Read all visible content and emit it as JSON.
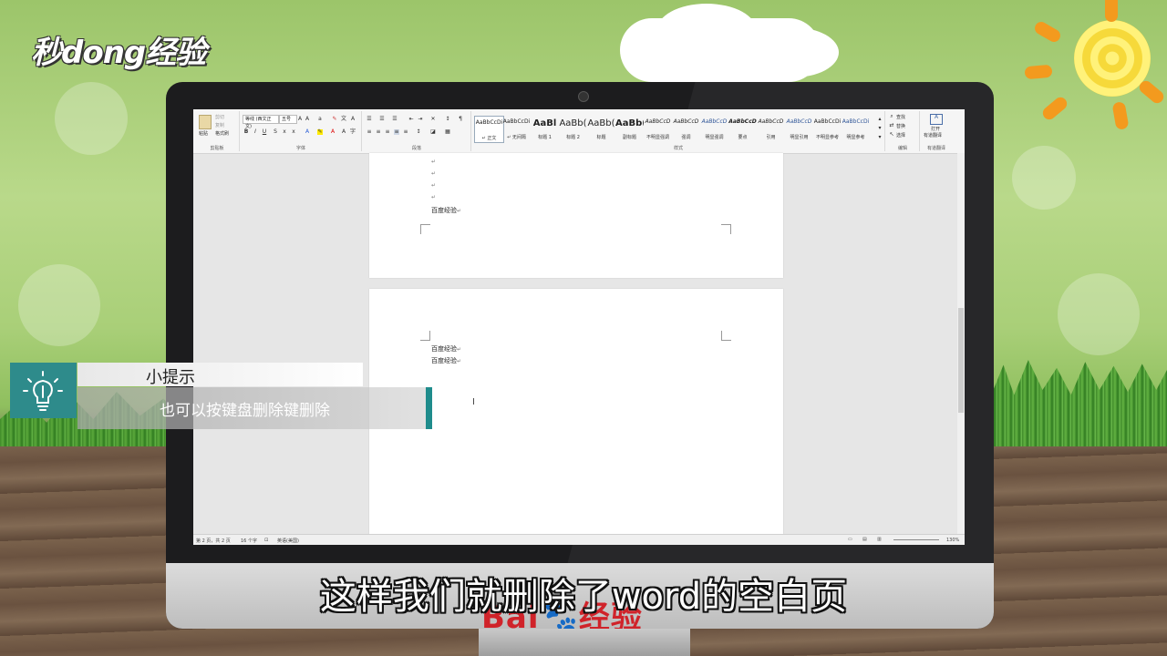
{
  "brand": {
    "logo": "秒dong经验",
    "stand_logo_a": "Bai",
    "stand_logo_b": "经验"
  },
  "ribbon": {
    "clipboard": {
      "label": "剪贴板",
      "paste": "粘贴",
      "cut": "剪切",
      "copy": "复制",
      "format_painter": "格式刷"
    },
    "font": {
      "label": "字体",
      "name": "等线 (西文正文)",
      "size": "五号"
    },
    "paragraph": {
      "label": "段落"
    },
    "styles": {
      "label": "样式",
      "items": [
        {
          "preview": "AaBbCcDi",
          "name": "↵ 正文"
        },
        {
          "preview": "AaBbCcDi",
          "name": "↵ 无间隔"
        },
        {
          "preview": "AaBl",
          "name": "标题 1"
        },
        {
          "preview": "AaBb(",
          "name": "标题 2"
        },
        {
          "preview": "AaBb(",
          "name": "标题"
        },
        {
          "preview": "AaBb(",
          "name": "副标题"
        },
        {
          "preview": "AaBbCcD",
          "name": "不明显强调"
        },
        {
          "preview": "AaBbCcD",
          "name": "强调"
        },
        {
          "preview": "AaBbCcD",
          "name": "明显强调"
        },
        {
          "preview": "AaBbCcD",
          "name": "要点"
        },
        {
          "preview": "AaBbCcD",
          "name": "引用"
        },
        {
          "preview": "AaBbCcD",
          "name": "明显引用"
        },
        {
          "preview": "AaBbCcDi",
          "name": "不明显参考"
        },
        {
          "preview": "AaBbCcDi",
          "name": "明显参考"
        }
      ]
    },
    "editing": {
      "label": "编辑",
      "find": "查找",
      "replace": "替换",
      "select": "选择"
    },
    "translate": {
      "label": "有道翻译",
      "button_line1": "打开",
      "button_line2": "有道翻译"
    }
  },
  "document": {
    "page1_line": "百度经验",
    "page2_lines": [
      "百度经验",
      "百度经验"
    ],
    "return_mark": "↵"
  },
  "status": {
    "page": "第 2 页，共 2 页",
    "words": "16 个字",
    "lang": "英语(美国)",
    "zoom": "130%"
  },
  "tip": {
    "title": "小提示",
    "body": "也可以按键盘删除键删除"
  },
  "subtitle": "这样我们就删除了word的空白页",
  "colors": {
    "teal": "#2e8b8b",
    "baidu_red": "#d0232a",
    "baidu_blue": "#2b5ed6"
  }
}
